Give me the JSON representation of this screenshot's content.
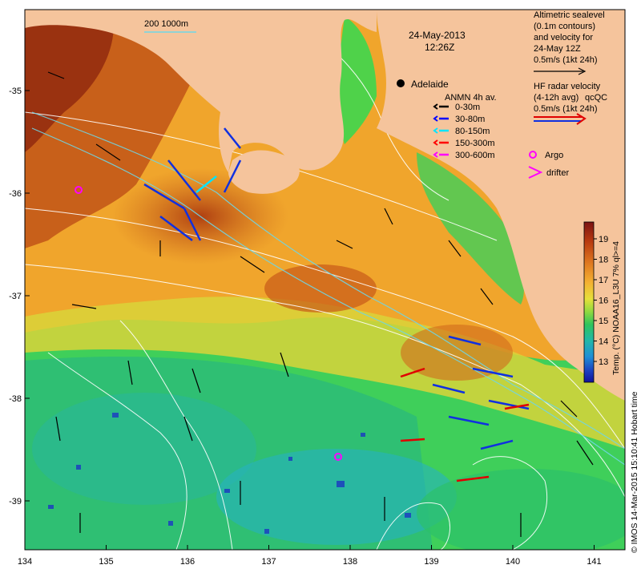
{
  "map": {
    "date": "24-May-2013",
    "time": "12:26Z",
    "city_label": "Adelaide",
    "scale_label": "200  1000m",
    "lon_ticks": [
      "134",
      "135",
      "136",
      "137",
      "138",
      "139",
      "140",
      "141"
    ],
    "lat_ticks": [
      "-35",
      "-36",
      "-37",
      "-38",
      "-39"
    ],
    "legend_anmn": {
      "title": "ANMN 4h av.",
      "items": [
        {
          "label": "0-30m",
          "color": "#000000"
        },
        {
          "label": "30-80m",
          "color": "#0000ff"
        },
        {
          "label": "80-150m",
          "color": "#00e5ff"
        },
        {
          "label": "150-300m",
          "color": "#ff0000"
        },
        {
          "label": "300-600m",
          "color": "#ff00ff"
        }
      ]
    },
    "legend_argo": "Argo",
    "legend_drifter": "drifter",
    "altimetry_text": [
      "Altimetric sealevel",
      "(0.1m contours)",
      "and velocity for",
      "24-May 12Z",
      "0.5m/s (1kt 24h)"
    ],
    "hf_radar_text": [
      "HF radar velocity",
      "(4-12h avg)",
      "0.5m/s (1kt 24h)"
    ],
    "hf_qc": "qcQC",
    "colorbar": {
      "ticks": [
        "19",
        "18",
        "17",
        "16",
        "15",
        "14",
        "13"
      ],
      "label": "Temp. (°C) NOAA16_L3U 7% ql>=4",
      "colors": [
        "#7a1212",
        "#b03a10",
        "#d8661c",
        "#f09628",
        "#f7c239",
        "#eadf3a",
        "#b6e03b",
        "#62cf45",
        "#2bbf66",
        "#21b8a6",
        "#21a7d6",
        "#1b76d8",
        "#1e34b8",
        "#12129a"
      ]
    },
    "credit": "© IMOS 14-Mar-2015 15:10:41 Hobart time",
    "colors": {
      "land": "#f5c49c",
      "sst_warm": "#c8601a",
      "sst_mid": "#f0b032",
      "sst_cool": "#3fcf5a",
      "sst_cold": "#24b0a0"
    }
  }
}
